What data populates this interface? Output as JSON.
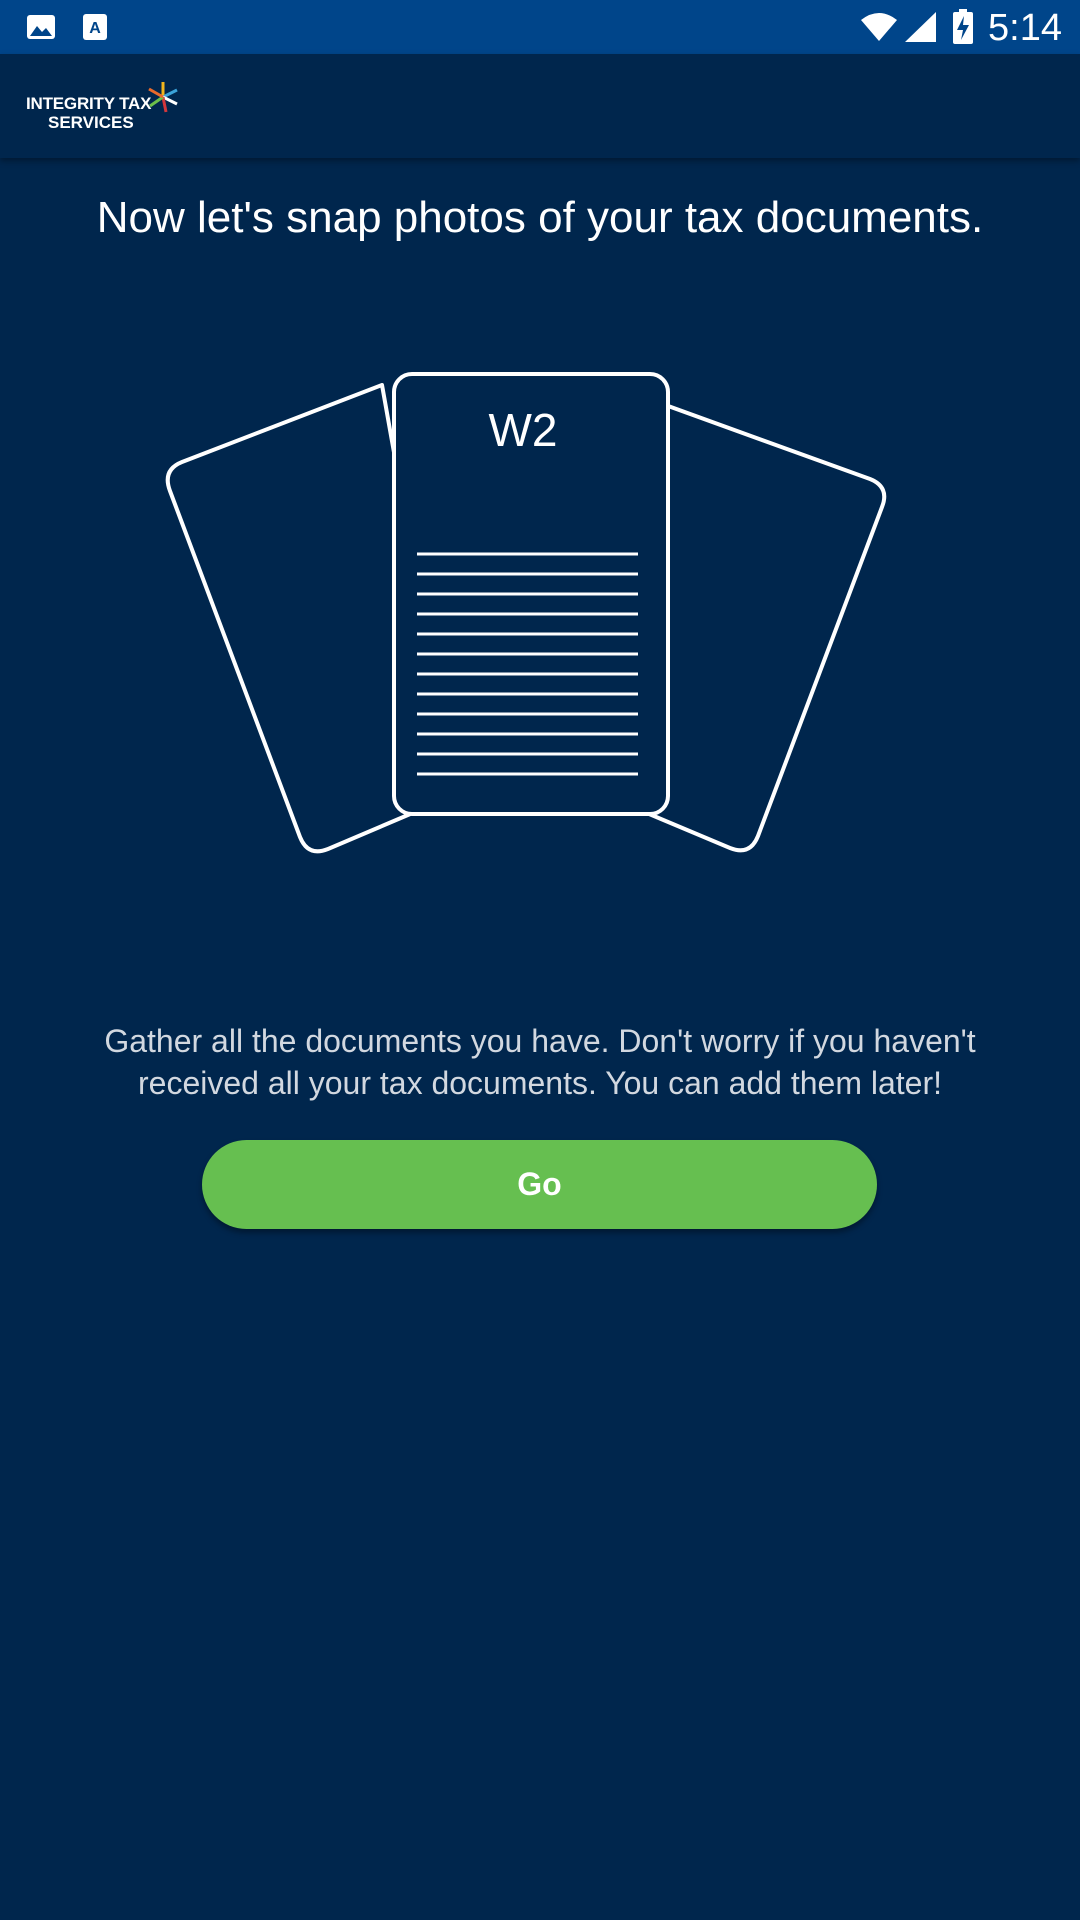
{
  "status_bar": {
    "time": "5:14",
    "left_icons": [
      "gallery-icon",
      "font-download-icon"
    ],
    "right_icons": [
      "wifi-icon",
      "cellular-signal-icon",
      "battery-charging-icon"
    ]
  },
  "app_bar": {
    "logo_line1": "INTEGRITY TAX",
    "logo_line2": "SERVICES"
  },
  "main": {
    "headline": "Now let's snap photos of your tax documents.",
    "illustration": {
      "document_label": "W2",
      "line_count": 12
    },
    "body_text": "Gather all the documents you have. Don't worry if you haven't received all your tax documents. You can add them later!",
    "go_button_label": "Go"
  },
  "colors": {
    "background": "#00264d",
    "status_bar": "#00458a",
    "button": "#66bf50",
    "text": "#ffffff"
  }
}
